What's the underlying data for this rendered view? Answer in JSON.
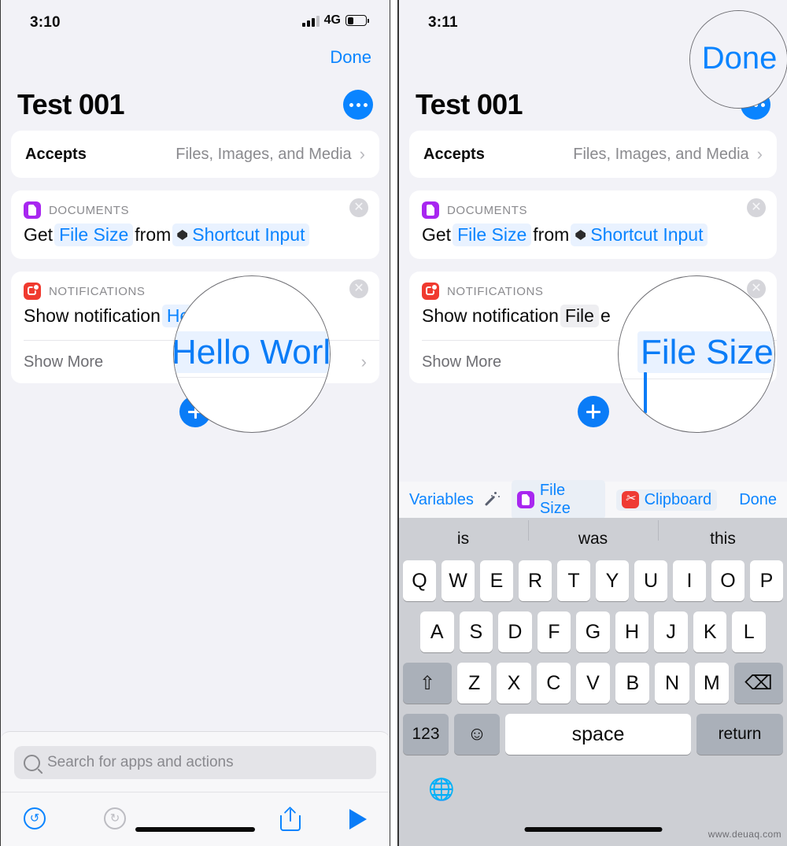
{
  "colors": {
    "accent": "#0a84ff",
    "documents_app": "#a826f0",
    "notifications_app": "#f03a2f",
    "clipboard_app": "#ef3b34",
    "canvas": "#f2f2f7",
    "keyboard_bg": "#cdcfd4"
  },
  "left_panel": {
    "status": {
      "time": "3:10",
      "network": "4G",
      "signal_bars": 4,
      "signal_filled": 3,
      "battery_percent": 30
    },
    "nav": {
      "done_label": "Done"
    },
    "title": "Test 001",
    "more_button": "more-options",
    "accepts": {
      "label": "Accepts",
      "value": "Files, Images, and Media"
    },
    "actions": [
      {
        "category": "DOCUMENTS",
        "icon": "document-icon",
        "parts": [
          {
            "type": "text",
            "text": "Get"
          },
          {
            "type": "token",
            "text": "File Size"
          },
          {
            "type": "text",
            "text": "from"
          },
          {
            "type": "token",
            "text": "Shortcut Input",
            "has_glyph": true
          }
        ],
        "has_remove": true,
        "show_more": null
      },
      {
        "category": "NOTIFICATIONS",
        "icon": "notification-icon",
        "parts": [
          {
            "type": "text",
            "text": "Show notification"
          },
          {
            "type": "token",
            "text": "Hello World"
          }
        ],
        "has_remove": true,
        "show_more": "Show More"
      }
    ],
    "add_button": "add-action",
    "search": {
      "placeholder": "Search for apps and actions"
    },
    "toolbar": {
      "undo": "undo-icon",
      "redo": "redo-icon",
      "share": "share-icon",
      "play": "run-icon"
    },
    "magnifier": {
      "text": "Hello World"
    }
  },
  "right_panel": {
    "status": {
      "time": "3:11",
      "network": "",
      "signal_bars": 0,
      "signal_filled": 0,
      "battery_percent": 0
    },
    "title": "Test 001",
    "accepts": {
      "label": "Accepts",
      "value": "Files, Images, and Media"
    },
    "actions": [
      {
        "category": "DOCUMENTS",
        "icon": "document-icon",
        "parts": [
          {
            "type": "text",
            "text": "Get"
          },
          {
            "type": "token",
            "text": "File Size"
          },
          {
            "type": "text",
            "text": "from"
          },
          {
            "type": "token",
            "text": "Shortcut Input",
            "has_glyph": true
          }
        ],
        "has_remove": true,
        "show_more": null
      },
      {
        "category": "NOTIFICATIONS",
        "icon": "notification-icon",
        "parts": [
          {
            "type": "text",
            "text": "Show notification"
          },
          {
            "type": "token_plain",
            "text": "File"
          },
          {
            "type": "text",
            "text": "e"
          }
        ],
        "has_remove": true,
        "show_more": "Show More"
      }
    ],
    "add_button": "add-action",
    "magnifier_done": {
      "text": "Done"
    },
    "magnifier_field": {
      "text": "File Size",
      "caret": true
    },
    "variables_bar": {
      "variables_label": "Variables",
      "wand_icon": "magic-wand-icon",
      "file_size_label": "File Size",
      "clipboard_label": "Clipboard",
      "done_label": "Done"
    },
    "keyboard": {
      "suggestions": [
        "is",
        "was",
        "this"
      ],
      "row1": [
        "Q",
        "W",
        "E",
        "R",
        "T",
        "Y",
        "U",
        "I",
        "O",
        "P"
      ],
      "row2": [
        "A",
        "S",
        "D",
        "F",
        "G",
        "H",
        "J",
        "K",
        "L"
      ],
      "row3": [
        "Z",
        "X",
        "C",
        "V",
        "B",
        "N",
        "M"
      ],
      "shift_label": "⇧",
      "backspace_label": "⌫",
      "numbers_label": "123",
      "emoji_label": "☺",
      "space_label": "space",
      "return_label": "return",
      "globe_label": "🌐"
    }
  },
  "watermark": "www.deuaq.com"
}
